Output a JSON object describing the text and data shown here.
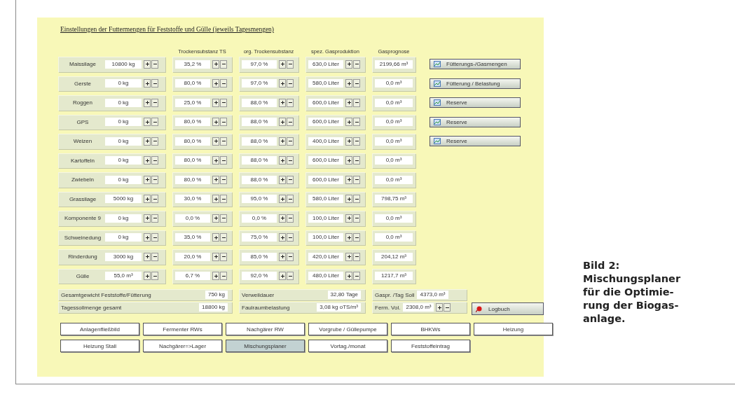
{
  "title": "Einstellungen der Futtermengen für Feststoffe und Gülle (jeweils Tagesmengen)",
  "column_headers": [
    "Trockensubstanz TS",
    "org. Trockensubstanz",
    "spez. Gasproduktion",
    "Gasprognose"
  ],
  "rows": [
    {
      "name": "Maissilage",
      "amount": "10800 kg",
      "ts": "35,2 %",
      "ots": "97,0 %",
      "gas": "630,0 Liter",
      "forecast": "2199,66 m³"
    },
    {
      "name": "Gerste",
      "amount": "0 kg",
      "ts": "80,0 %",
      "ots": "97,0 %",
      "gas": "580,0 Liter",
      "forecast": "0,0 m³"
    },
    {
      "name": "Roggen",
      "amount": "0 kg",
      "ts": "25,0 %",
      "ots": "88,0 %",
      "gas": "600,0 Liter",
      "forecast": "0,0 m³"
    },
    {
      "name": "GPS",
      "amount": "0 kg",
      "ts": "80,0 %",
      "ots": "88,0 %",
      "gas": "600,0 Liter",
      "forecast": "0,0 m³"
    },
    {
      "name": "Weizen",
      "amount": "0 kg",
      "ts": "80,0 %",
      "ots": "88,0 %",
      "gas": "400,0 Liter",
      "forecast": "0,0 m³"
    },
    {
      "name": "Kartoffeln",
      "amount": "0 kg",
      "ts": "80,0 %",
      "ots": "88,0 %",
      "gas": "600,0 Liter",
      "forecast": "0,0 m³"
    },
    {
      "name": "Zwiebeln",
      "amount": "0 kg",
      "ts": "80,0 %",
      "ots": "88,0 %",
      "gas": "600,0 Liter",
      "forecast": "0,0 m³"
    },
    {
      "name": "Grassilage",
      "amount": "5000 kg",
      "ts": "30,0 %",
      "ots": "95,0 %",
      "gas": "580,0 Liter",
      "forecast": "798,75 m³"
    },
    {
      "name": "Komponente 9",
      "amount": "0 kg",
      "ts": "0,0 %",
      "ots": "0,0 %",
      "gas": "100,0 Liter",
      "forecast": "0,0 m³"
    },
    {
      "name": "Schweinedung",
      "amount": "0 kg",
      "ts": "35,0 %",
      "ots": "75,0 %",
      "gas": "100,0 Liter",
      "forecast": "0,0 m³"
    },
    {
      "name": "Rinderdung",
      "amount": "3000 kg",
      "ts": "20,0 %",
      "ots": "85,0 %",
      "gas": "420,0 Liter",
      "forecast": "204,12 m³"
    },
    {
      "name": "Gülle",
      "amount": "55,0 m³",
      "ts": "6,7 %",
      "ots": "92,0 %",
      "gas": "480,0 Liter",
      "forecast": "1217,7 m³"
    }
  ],
  "side_buttons": [
    {
      "label": "Fütterungs-/Gasmengen"
    },
    {
      "label": "Fütterung / Belastung"
    },
    {
      "label": "Reserve"
    },
    {
      "label": "Reserve"
    },
    {
      "label": "Reserve"
    }
  ],
  "summary": [
    {
      "kind": "readout",
      "label": "Gesamtgewicht Feststoffe/Fütterung",
      "value": "750 kg"
    },
    {
      "kind": "readout",
      "label": "Verweildauer",
      "value": "32,80 Tage"
    },
    {
      "kind": "readout",
      "label": "Gaspr. /Tag Soll",
      "value": "4373,0 m³"
    },
    {
      "kind": "readout",
      "label": "Tagessollmenge gesamt",
      "value": "18800 kg"
    },
    {
      "kind": "readout",
      "label": "Faulraumbelastung",
      "value": "3,08 kg oTS/m³"
    },
    {
      "kind": "spinner",
      "label": "Ferm. Vol.",
      "value": "2308,0 m³"
    }
  ],
  "logbook_button": {
    "label": "Logbuch"
  },
  "nav": [
    {
      "label": "Anlagenfließbild",
      "selected": false
    },
    {
      "label": "Fermenter RWs",
      "selected": false
    },
    {
      "label": "Nachgärer RW",
      "selected": false
    },
    {
      "label": "Vorgrube / Güllepumpe",
      "selected": false
    },
    {
      "label": "BHKWs",
      "selected": false
    },
    {
      "label": "Heizung",
      "selected": false
    },
    {
      "label": "Heizung Stall",
      "selected": false
    },
    {
      "label": "Nachgärer=>Lager",
      "selected": false
    },
    {
      "label": "Mischungsplaner",
      "selected": true
    },
    {
      "label": "Vortag./monat",
      "selected": false
    },
    {
      "label": "Feststoffeintrag",
      "selected": false
    }
  ],
  "caption": [
    "Bild 2:",
    "Mischungsplaner",
    "für die Optimie-",
    "rung der Biogas-",
    "anlage."
  ]
}
